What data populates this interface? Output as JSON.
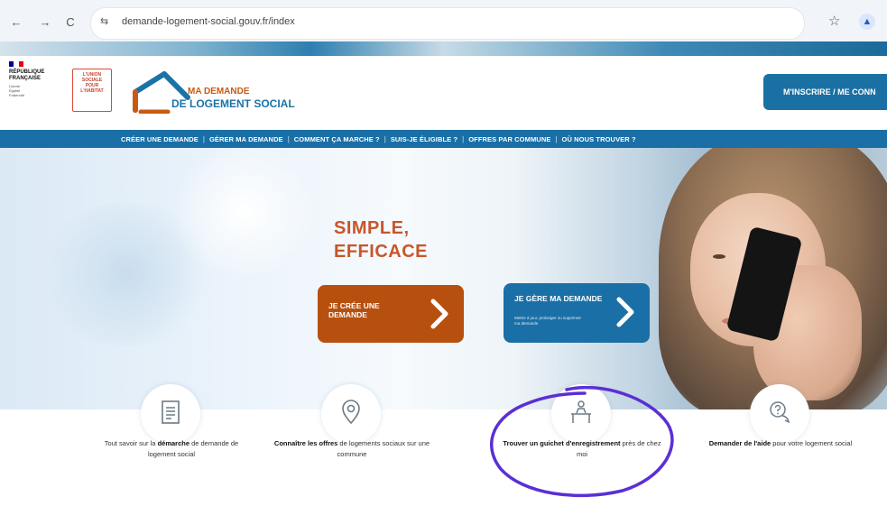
{
  "browser": {
    "url": "demande-logement-social.gouv.fr/index",
    "back_icon": "←",
    "forward_icon": "→",
    "reload_icon": "C",
    "site_info_icon": "⇆",
    "bookmark_icon": "☆",
    "profile_icon": "▲"
  },
  "header": {
    "republique_text": "RÉPUBLIQUE\nFRANÇAISE",
    "motto": "Liberté\nÉgalité\nFraternité",
    "union_text": "L'UNION\nSOCIALE\nPOUR\nL'HABITAT",
    "brand_line1": "MA DEMANDE",
    "brand_line2": "DE LOGEMENT SOCIAL",
    "signup_label": "M'INSCRIRE / ME CONN",
    "colors": {
      "blue": "#1a6fa6",
      "orange": "#b7500f",
      "title": "#c8562a"
    }
  },
  "nav": {
    "items": [
      "CRÉER UNE DEMANDE",
      "GÉRER MA DEMANDE",
      "COMMENT ÇA MARCHE ?",
      "SUIS-JE ÉLIGIBLE ?",
      "OFFRES PAR COMMUNE",
      "OÙ NOUS TROUVER ?"
    ],
    "separator": "|"
  },
  "hero": {
    "title": "SIMPLE,\nEFFICACE",
    "cta_create": "JE CRÉE UNE DEMANDE",
    "cta_manage": "JE GÈRE MA DEMANDE",
    "cta_manage_sub": "Mettre à jour, prolonger ou supprimer ma demande"
  },
  "services": [
    {
      "icon": "document-icon",
      "bold_prefix": "",
      "text_a": "Tout savoir sur la ",
      "bold": "démarche",
      "text_b": " de demande de logement social"
    },
    {
      "icon": "location-pin-icon",
      "text_a": "",
      "bold": "Connaître les offres",
      "text_b": " de logements sociaux sur une commune"
    },
    {
      "icon": "counter-desk-icon",
      "text_a": "",
      "bold": "Trouver un guichet d'enregistrement",
      "text_b": " près de chez moi"
    },
    {
      "icon": "help-chat-icon",
      "text_a": "",
      "bold": "Demander de l'aide",
      "text_b": " pour votre logement social"
    }
  ],
  "annotation": {
    "color": "#5a2fd6",
    "target": "counter-desk service"
  }
}
